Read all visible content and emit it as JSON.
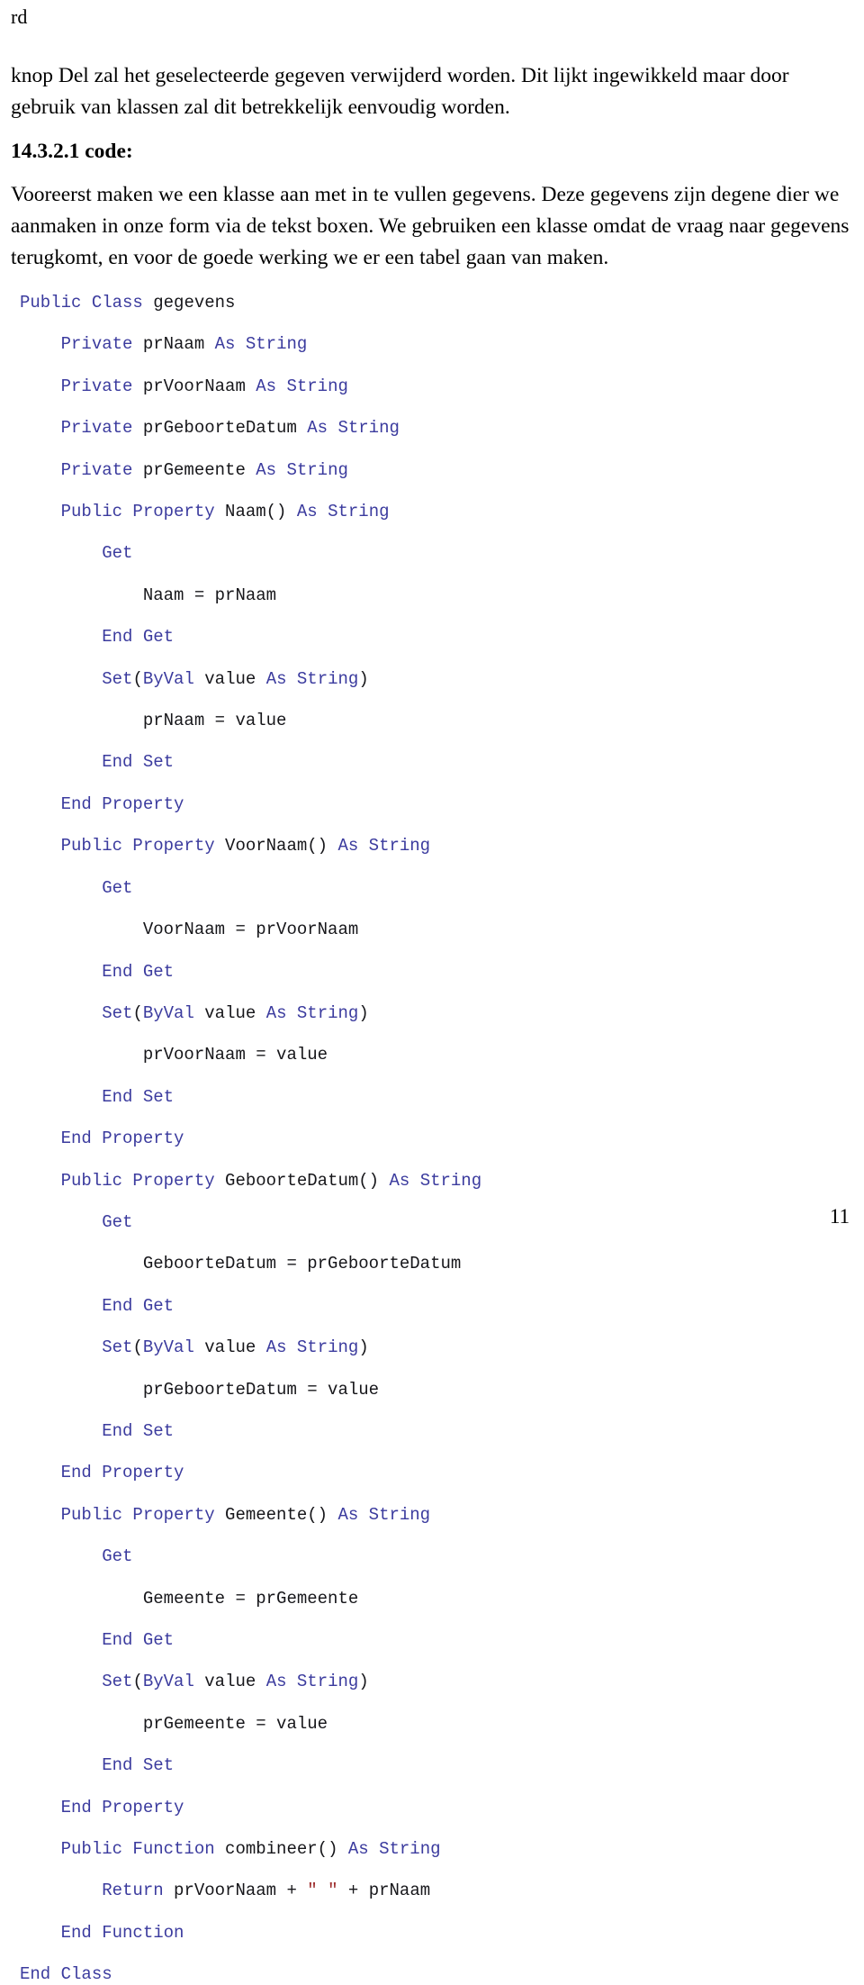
{
  "document": {
    "running_head": "rd",
    "page_number": "11",
    "paragraphs": [
      "knop Del zal het geselecteerde gegeven verwijderd worden. Dit lijkt ingewikkeld maar door gebruik van klassen zal dit betrekkelijk eenvoudig worden.",
      "Vooreerst maken we een klasse aan met in te vullen gegevens. Deze gegevens zijn degene dier we aanmaken in onze form via de tekst boxen. We gebruiken een klasse omdat de vraag naar gegevens terugkomt, en voor de goede werking we er een tabel gaan van maken."
    ],
    "heading": "14.3.2.1 code:",
    "code": {
      "language": "Visual Basic .NET",
      "lines": [
        [
          {
            "t": "Public Class ",
            "c": "kw"
          },
          {
            "t": "gegevens",
            "c": "id"
          }
        ],
        [
          {
            "t": "    ",
            "c": "id"
          },
          {
            "t": "Private ",
            "c": "kw"
          },
          {
            "t": "prNaam ",
            "c": "id"
          },
          {
            "t": "As String",
            "c": "kw"
          }
        ],
        [
          {
            "t": "    ",
            "c": "id"
          },
          {
            "t": "Private ",
            "c": "kw"
          },
          {
            "t": "prVoorNaam ",
            "c": "id"
          },
          {
            "t": "As String",
            "c": "kw"
          }
        ],
        [
          {
            "t": "    ",
            "c": "id"
          },
          {
            "t": "Private ",
            "c": "kw"
          },
          {
            "t": "prGeboorteDatum ",
            "c": "id"
          },
          {
            "t": "As String",
            "c": "kw"
          }
        ],
        [
          {
            "t": "    ",
            "c": "id"
          },
          {
            "t": "Private ",
            "c": "kw"
          },
          {
            "t": "prGemeente ",
            "c": "id"
          },
          {
            "t": "As String",
            "c": "kw"
          }
        ],
        [
          {
            "t": "    ",
            "c": "id"
          },
          {
            "t": "Public Property ",
            "c": "kw"
          },
          {
            "t": "Naam() ",
            "c": "id"
          },
          {
            "t": "As String",
            "c": "kw"
          }
        ],
        [
          {
            "t": "        ",
            "c": "id"
          },
          {
            "t": "Get",
            "c": "kw"
          }
        ],
        [
          {
            "t": "            Naam = prNaam",
            "c": "id"
          }
        ],
        [
          {
            "t": "        ",
            "c": "id"
          },
          {
            "t": "End Get",
            "c": "kw"
          }
        ],
        [
          {
            "t": "        ",
            "c": "id"
          },
          {
            "t": "Set",
            "c": "kw"
          },
          {
            "t": "(",
            "c": "id"
          },
          {
            "t": "ByVal ",
            "c": "kw"
          },
          {
            "t": "value ",
            "c": "id"
          },
          {
            "t": "As String",
            "c": "kw"
          },
          {
            "t": ")",
            "c": "id"
          }
        ],
        [
          {
            "t": "            prNaam = value",
            "c": "id"
          }
        ],
        [
          {
            "t": "        ",
            "c": "id"
          },
          {
            "t": "End Set",
            "c": "kw"
          }
        ],
        [
          {
            "t": "    ",
            "c": "id"
          },
          {
            "t": "End Property",
            "c": "kw"
          }
        ],
        [
          {
            "t": "    ",
            "c": "id"
          },
          {
            "t": "Public Property ",
            "c": "kw"
          },
          {
            "t": "VoorNaam() ",
            "c": "id"
          },
          {
            "t": "As String",
            "c": "kw"
          }
        ],
        [
          {
            "t": "        ",
            "c": "id"
          },
          {
            "t": "Get",
            "c": "kw"
          }
        ],
        [
          {
            "t": "            VoorNaam = prVoorNaam",
            "c": "id"
          }
        ],
        [
          {
            "t": "        ",
            "c": "id"
          },
          {
            "t": "End Get",
            "c": "kw"
          }
        ],
        [
          {
            "t": "        ",
            "c": "id"
          },
          {
            "t": "Set",
            "c": "kw"
          },
          {
            "t": "(",
            "c": "id"
          },
          {
            "t": "ByVal ",
            "c": "kw"
          },
          {
            "t": "value ",
            "c": "id"
          },
          {
            "t": "As String",
            "c": "kw"
          },
          {
            "t": ")",
            "c": "id"
          }
        ],
        [
          {
            "t": "            prVoorNaam = value",
            "c": "id"
          }
        ],
        [
          {
            "t": "        ",
            "c": "id"
          },
          {
            "t": "End Set",
            "c": "kw"
          }
        ],
        [
          {
            "t": "    ",
            "c": "id"
          },
          {
            "t": "End Property",
            "c": "kw"
          }
        ],
        [
          {
            "t": "    ",
            "c": "id"
          },
          {
            "t": "Public Property ",
            "c": "kw"
          },
          {
            "t": "GeboorteDatum() ",
            "c": "id"
          },
          {
            "t": "As String",
            "c": "kw"
          }
        ],
        [
          {
            "t": "        ",
            "c": "id"
          },
          {
            "t": "Get",
            "c": "kw"
          }
        ],
        [
          {
            "t": "            GeboorteDatum = prGeboorteDatum",
            "c": "id"
          }
        ],
        [
          {
            "t": "        ",
            "c": "id"
          },
          {
            "t": "End Get",
            "c": "kw"
          }
        ],
        [
          {
            "t": "        ",
            "c": "id"
          },
          {
            "t": "Set",
            "c": "kw"
          },
          {
            "t": "(",
            "c": "id"
          },
          {
            "t": "ByVal ",
            "c": "kw"
          },
          {
            "t": "value ",
            "c": "id"
          },
          {
            "t": "As String",
            "c": "kw"
          },
          {
            "t": ")",
            "c": "id"
          }
        ],
        [
          {
            "t": "            prGeboorteDatum = value",
            "c": "id"
          }
        ],
        [
          {
            "t": "        ",
            "c": "id"
          },
          {
            "t": "End Set",
            "c": "kw"
          }
        ],
        [
          {
            "t": "    ",
            "c": "id"
          },
          {
            "t": "End Property",
            "c": "kw"
          }
        ],
        [
          {
            "t": "    ",
            "c": "id"
          },
          {
            "t": "Public Property ",
            "c": "kw"
          },
          {
            "t": "Gemeente() ",
            "c": "id"
          },
          {
            "t": "As String",
            "c": "kw"
          }
        ],
        [
          {
            "t": "        ",
            "c": "id"
          },
          {
            "t": "Get",
            "c": "kw"
          }
        ],
        [
          {
            "t": "            Gemeente = prGemeente",
            "c": "id"
          }
        ],
        [
          {
            "t": "        ",
            "c": "id"
          },
          {
            "t": "End Get",
            "c": "kw"
          }
        ],
        [
          {
            "t": "        ",
            "c": "id"
          },
          {
            "t": "Set",
            "c": "kw"
          },
          {
            "t": "(",
            "c": "id"
          },
          {
            "t": "ByVal ",
            "c": "kw"
          },
          {
            "t": "value ",
            "c": "id"
          },
          {
            "t": "As String",
            "c": "kw"
          },
          {
            "t": ")",
            "c": "id"
          }
        ],
        [
          {
            "t": "            prGemeente = value",
            "c": "id"
          }
        ],
        [
          {
            "t": "        ",
            "c": "id"
          },
          {
            "t": "End Set",
            "c": "kw"
          }
        ],
        [
          {
            "t": "    ",
            "c": "id"
          },
          {
            "t": "End Property",
            "c": "kw"
          }
        ],
        [
          {
            "t": "    ",
            "c": "id"
          },
          {
            "t": "Public Function ",
            "c": "kw"
          },
          {
            "t": "combineer() ",
            "c": "id"
          },
          {
            "t": "As String",
            "c": "kw"
          }
        ],
        [
          {
            "t": "        ",
            "c": "id"
          },
          {
            "t": "Return ",
            "c": "kw"
          },
          {
            "t": "prVoorNaam + ",
            "c": "id"
          },
          {
            "t": "\" \"",
            "c": "str"
          },
          {
            "t": " + prNaam",
            "c": "id"
          }
        ],
        [
          {
            "t": "    ",
            "c": "id"
          },
          {
            "t": "End Function",
            "c": "kw"
          }
        ],
        [
          {
            "t": "End Class",
            "c": "kw"
          }
        ]
      ]
    },
    "colors": {
      "keyword": "#3b3b9e",
      "identifier": "#16161a",
      "string": "#9d2b2b",
      "text": "#000000",
      "background": "#ffffff"
    }
  }
}
